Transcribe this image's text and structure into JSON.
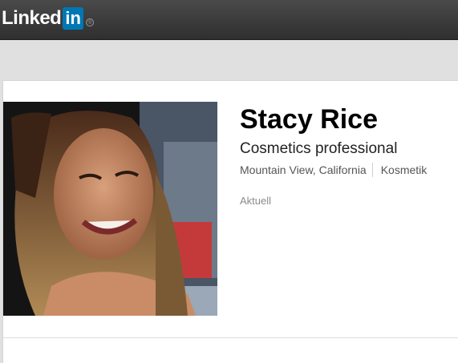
{
  "header": {
    "logo_word": "Linked",
    "logo_in": "in",
    "logo_reg": "®"
  },
  "profile": {
    "name": "Stacy Rice",
    "headline": "Cosmetics professional",
    "location": "Mountain View, California",
    "industry": "Kosmetik",
    "current_label": "Aktuell"
  },
  "colors": {
    "brand_blue": "#0077b5",
    "topbar": "#3a3a3a"
  }
}
